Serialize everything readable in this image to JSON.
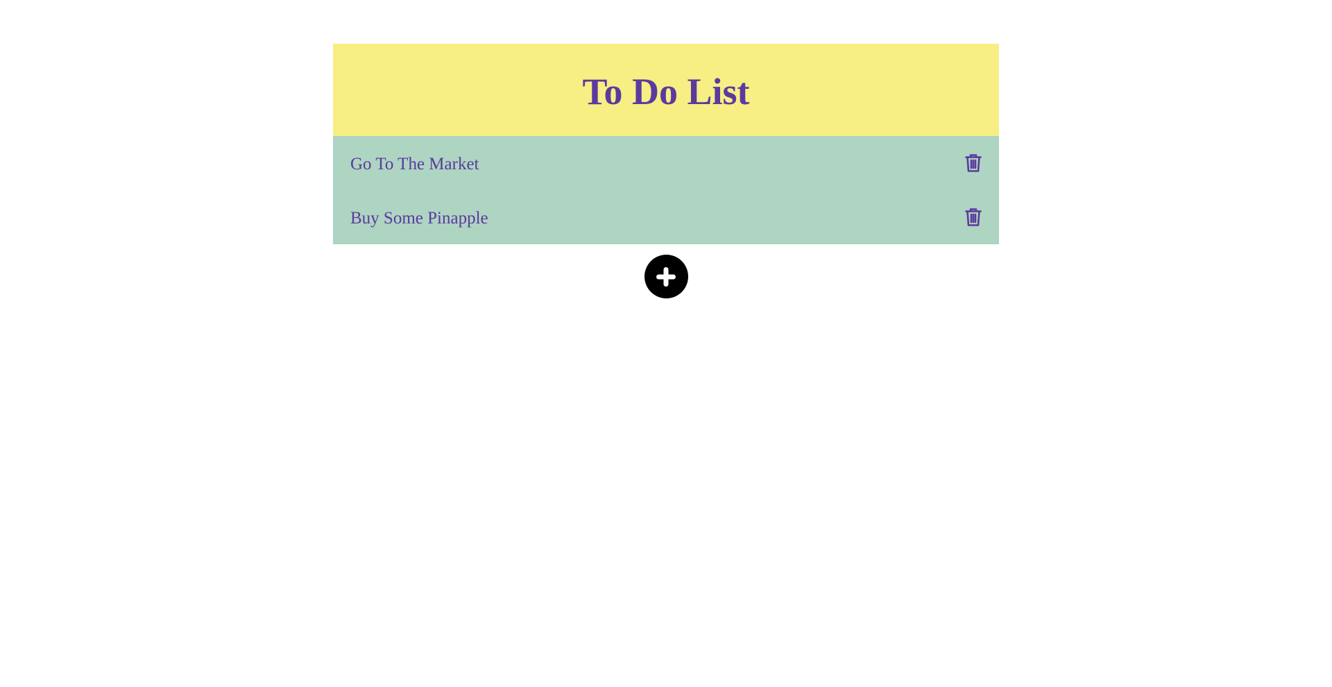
{
  "header": {
    "title": "To Do List"
  },
  "todos": [
    {
      "label": "Go To The Market",
      "delete_icon": "trash-icon"
    },
    {
      "label": "Buy Some Pinapple",
      "delete_icon": "trash-icon"
    }
  ],
  "add_button": {
    "icon": "plus-icon"
  },
  "colors": {
    "header_bg": "#f7ee84",
    "list_bg": "#aed4c2",
    "text": "#5b3a9e",
    "add_bg": "#000000",
    "add_icon": "#ffffff"
  }
}
